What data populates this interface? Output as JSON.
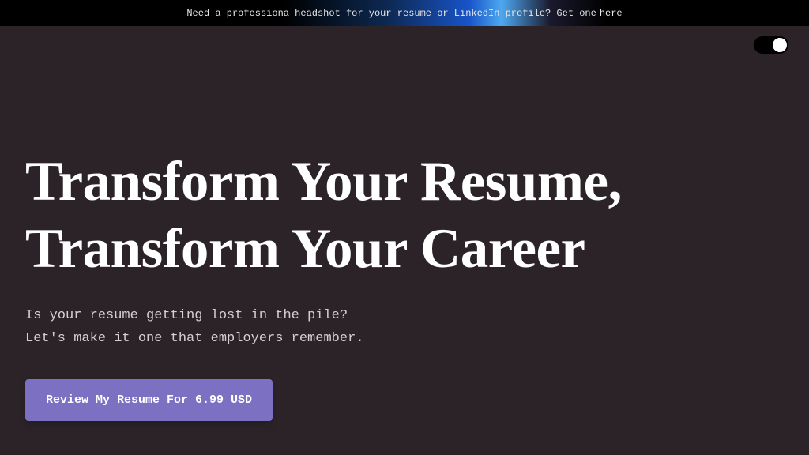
{
  "banner": {
    "text": "Need a professiona headshot for your resume or LinkedIn profile? Get one ",
    "link_text": "here"
  },
  "hero": {
    "headline_line1": "Transform Your Resume,",
    "headline_line2": "Transform Your Career",
    "subtext_line1": "Is your resume getting lost in the pile?",
    "subtext_line2": "Let's make it one that employers remember."
  },
  "cta": {
    "label": "Review My Resume For 6.99 USD"
  }
}
